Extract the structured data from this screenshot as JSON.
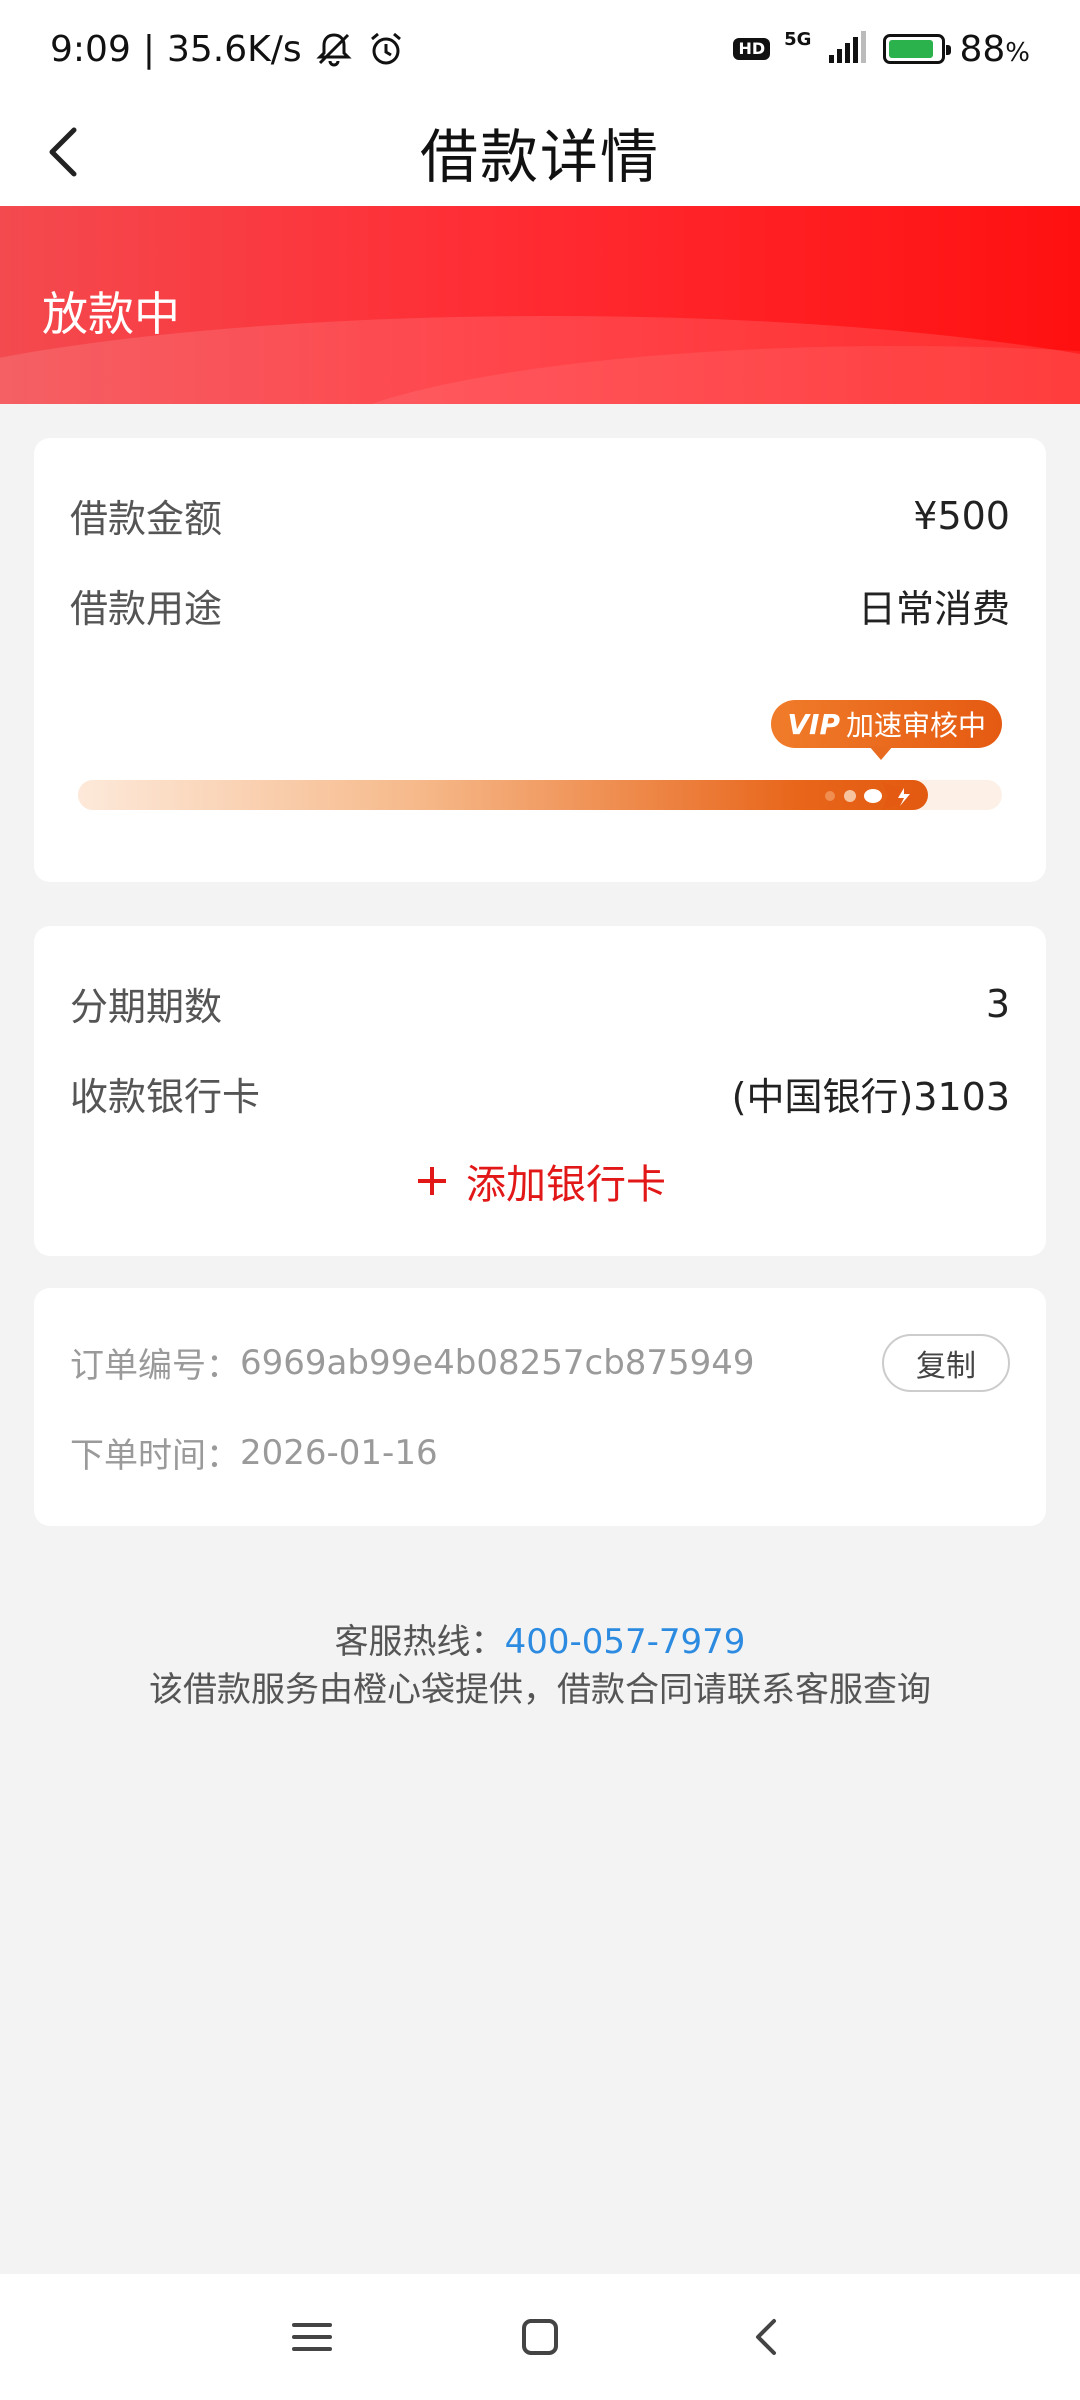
{
  "status_bar": {
    "time": "9:09",
    "separator": "|",
    "net_speed": "35.6K/s",
    "hd_label": "HD",
    "network_type": "5G",
    "battery_percent": "88",
    "battery_unit": "%",
    "battery_level": 0.88
  },
  "nav": {
    "title": "借款详情"
  },
  "banner": {
    "status_text": "放款中"
  },
  "loan_card": {
    "amount_label": "借款金额",
    "amount_value": "¥500",
    "purpose_label": "借款用途",
    "purpose_value": "日常消费",
    "progress_tag_vip": "VIP",
    "progress_tag_text": "加速审核中",
    "progress_fraction": 0.92
  },
  "installment_card": {
    "periods_label": "分期期数",
    "periods_value": "3",
    "bank_label": "收款银行卡",
    "bank_value": "(中国银行)3103",
    "add_bank_label": "添加银行卡"
  },
  "order_card": {
    "order_no_label": "订单编号：",
    "order_no_value": "6969ab99e4b08257cb875949",
    "copy_label": "复制",
    "order_time_label": "下单时间：",
    "order_time_value": "2026-01-16"
  },
  "footer": {
    "hotline_label": "客服热线：",
    "hotline_number": "400-057-7979",
    "notice": "该借款服务由橙心袋提供，借款合同请联系客服查询"
  },
  "colors": {
    "accent_red": "#ff2d34",
    "progress_orange": "#e8651a",
    "link_blue": "#2c8be0"
  }
}
